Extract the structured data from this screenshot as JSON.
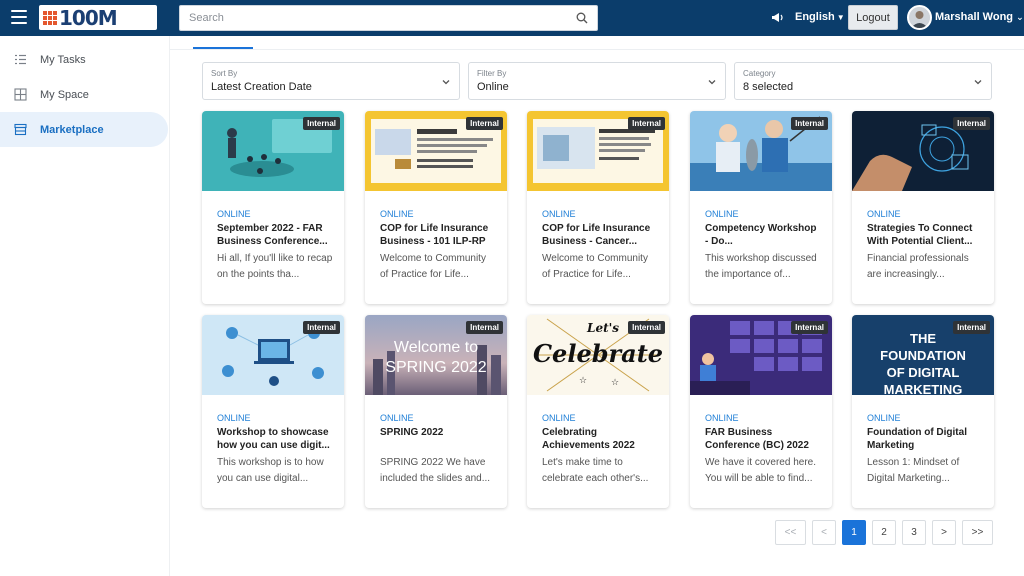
{
  "header": {
    "logo_text": "100M",
    "search_placeholder": "Search",
    "language": "English",
    "logout_label": "Logout",
    "user_name": "Marshall Wong"
  },
  "sidebar": {
    "items": [
      {
        "label": "My Tasks",
        "icon": "tasks-icon",
        "active": false
      },
      {
        "label": "My Space",
        "icon": "grid-icon",
        "active": false
      },
      {
        "label": "Marketplace",
        "icon": "store-icon",
        "active": true
      }
    ]
  },
  "filters": {
    "sort": {
      "label": "Sort By",
      "value": "Latest Creation Date"
    },
    "filter": {
      "label": "Filter By",
      "value": "Online"
    },
    "category": {
      "label": "Category",
      "value": "8 selected"
    }
  },
  "cards": [
    {
      "badge": "Internal",
      "status": "ONLINE",
      "title": "September 2022 - FAR Business Conference...",
      "desc": "Hi all, If you'll like to recap on the points tha...",
      "thumb": "conference"
    },
    {
      "badge": "Internal",
      "status": "ONLINE",
      "title": "COP for Life Insurance Business - 101 ILP-RP",
      "desc": "Welcome to Community of Practice for Life...",
      "thumb": "cop-ilp"
    },
    {
      "badge": "Internal",
      "status": "ONLINE",
      "title": "COP for Life Insurance Business - Cancer...",
      "desc": "Welcome to Community of Practice for Life...",
      "thumb": "cop-cancer"
    },
    {
      "badge": "Internal",
      "status": "ONLINE",
      "title": "Competency Workshop - Do...",
      "desc": "This workshop discussed the importance of...",
      "thumb": "fishing"
    },
    {
      "badge": "Internal",
      "status": "ONLINE",
      "title": "Strategies To Connect With Potential Client...",
      "desc": "Financial professionals are increasingly...",
      "thumb": "digital-hand"
    },
    {
      "badge": "Internal",
      "status": "ONLINE",
      "title": "Workshop to showcase how you can use digit...",
      "desc": "This workshop is to how you can use digital...",
      "thumb": "network"
    },
    {
      "badge": "Internal",
      "status": "ONLINE",
      "title": "SPRING 2022",
      "desc": "SPRING 2022 We have included the slides and...",
      "thumb": "spring",
      "thumb_text_1": "Welcome to",
      "thumb_text_2": "SPRING 2022"
    },
    {
      "badge": "Internal",
      "status": "ONLINE",
      "title": "Celebrating Achievements 2022",
      "desc": "Let's make time to celebrate each other's...",
      "thumb": "celebrate",
      "thumb_text_1": "Let's",
      "thumb_text_2": "Celebrate"
    },
    {
      "badge": "Internal",
      "status": "ONLINE",
      "title": "FAR Business Conference (BC) 2022",
      "desc": "We have it covered here. You will be able to find...",
      "thumb": "videocall"
    },
    {
      "badge": "Internal",
      "status": "ONLINE",
      "title": "Foundation of Digital Marketing",
      "desc": "Lesson 1: Mindset of Digital Marketing...",
      "thumb": "foundation",
      "thumb_text_1": "THE",
      "thumb_text_2": "FOUNDATION",
      "thumb_text_3": "OF DIGITAL",
      "thumb_text_4": "MARKETING"
    }
  ],
  "pagination": [
    "<<",
    "<",
    "1",
    "2",
    "3",
    ">",
    ">>"
  ],
  "pagination_active": "1",
  "colors": {
    "header_bg": "#0b3d6b",
    "accent": "#1a73d9",
    "status_text": "#1f7fd6",
    "active_nav_bg": "#e8f1fb"
  }
}
